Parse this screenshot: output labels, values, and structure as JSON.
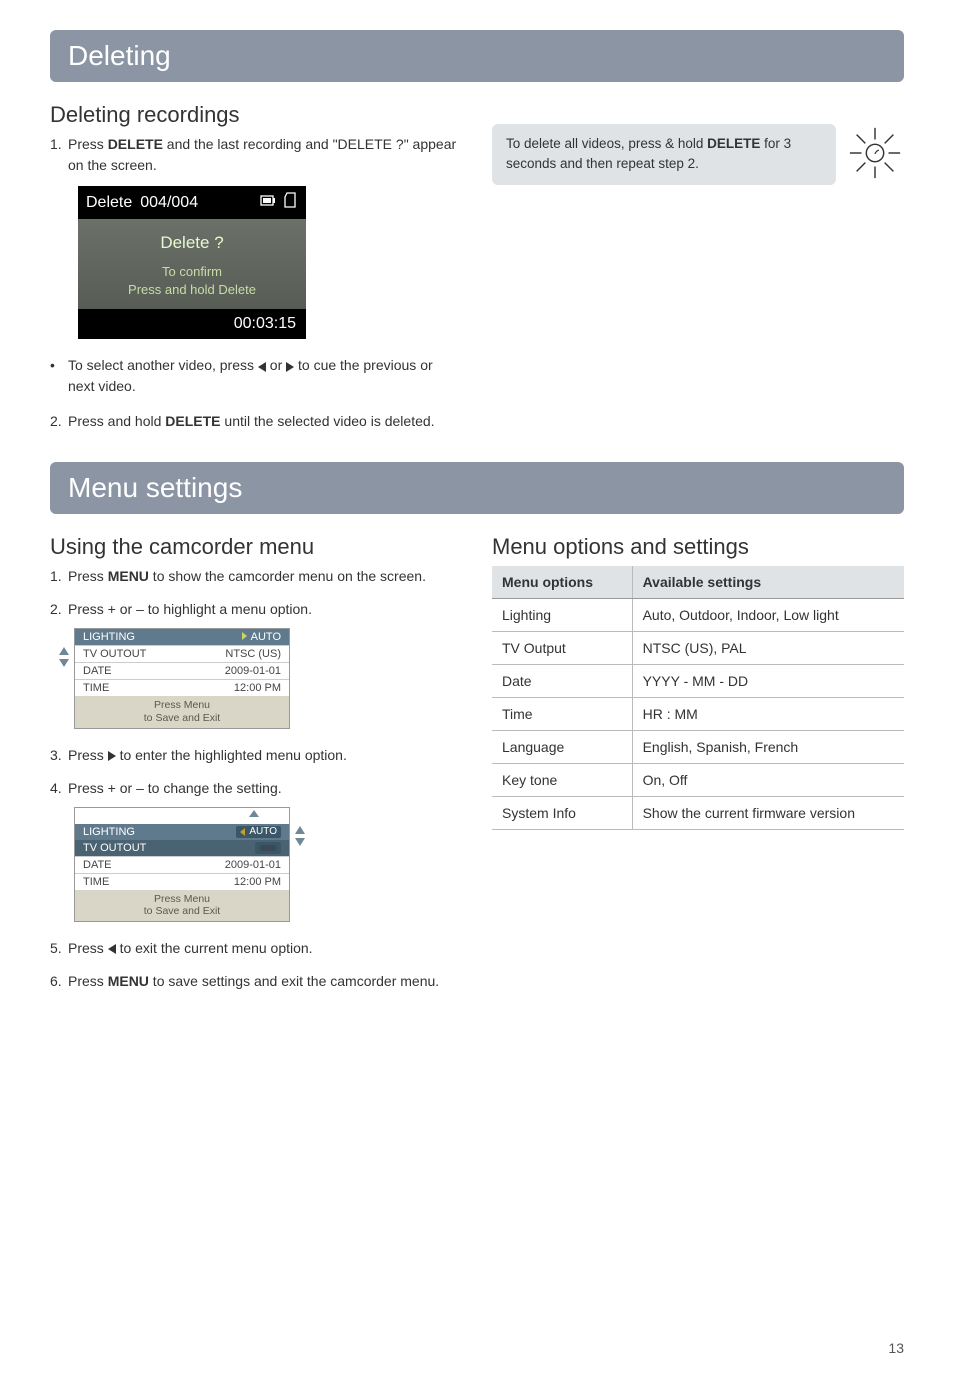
{
  "section1": {
    "heading": "Deleting",
    "sub_heading": "Deleting recordings",
    "step1_num": "1.",
    "step1_pre": "Press ",
    "step1_bold": "DELETE",
    "step1_post": " and the last recording and \"DELETE ?\" appear on the screen.",
    "cam": {
      "delete_label": "Delete",
      "counter": "004/004",
      "question": "Delete ?",
      "hint1": "To confirm",
      "hint2": "Press and hold Delete",
      "time": "00:03:15"
    },
    "bullet_pre": "To select another video, press ",
    "bullet_mid": " or ",
    "bullet_post": " to cue the previous or next video.",
    "step2_num": "2.",
    "step2_pre": "Press and hold ",
    "step2_bold": "DELETE",
    "step2_post": " until the selected video is deleted.",
    "tip_pre": "To delete all videos, press & hold ",
    "tip_bold": "DELETE",
    "tip_post": " for 3 seconds and then repeat step 2."
  },
  "section2": {
    "heading": "Menu settings",
    "left": {
      "sub_heading": "Using the camcorder menu",
      "s1_num": "1.",
      "s1_pre": "Press ",
      "s1_bold": "MENU",
      "s1_post": " to show the camcorder menu on the screen.",
      "s2_num": "2.",
      "s2_text": "Press + or – to highlight a menu option.",
      "lcd1": {
        "r1a": "LIGHTING",
        "r1b": "AUTO",
        "r2a": "TV OUTOUT",
        "r2b": "NTSC (US)",
        "r3a": "DATE",
        "r3b": "2009-01-01",
        "r4a": "TIME",
        "r4b": "12:00 PM",
        "f1": "Press Menu",
        "f2": "to Save and Exit"
      },
      "s3_num": "3.",
      "s3_pre": "Press ",
      "s3_post": " to enter the highlighted menu option.",
      "s4_num": "4.",
      "s4_text": "Press + or – to change the setting.",
      "lcd2": {
        "r1a": "LIGHTING",
        "r1b": "AUTO",
        "r2a": "TV OUTOUT",
        "r2b": "",
        "r3a": "DATE",
        "r3b": "2009-01-01",
        "r4a": "TIME",
        "r4b": "12:00 PM",
        "f1": "Press Menu",
        "f2": "to Save and Exit"
      },
      "s5_num": "5.",
      "s5_pre": "Press ",
      "s5_post": " to exit the current menu option.",
      "s6_num": "6.",
      "s6_pre": "Press ",
      "s6_bold": "MENU",
      "s6_post": " to save settings and exit the camcorder menu."
    },
    "right": {
      "sub_heading": "Menu options and settings",
      "th1": "Menu options",
      "th2": "Available settings",
      "rows": [
        {
          "a": "Lighting",
          "b": "Auto, Outdoor, Indoor, Low light"
        },
        {
          "a": "TV Output",
          "b": "NTSC (US), PAL"
        },
        {
          "a": "Date",
          "b": "YYYY - MM - DD"
        },
        {
          "a": "Time",
          "b": "HR : MM"
        },
        {
          "a": "Language",
          "b": "English, Spanish, French"
        },
        {
          "a": "Key tone",
          "b": "On, Off"
        },
        {
          "a": "System Info",
          "b": "Show the current firmware version"
        }
      ]
    }
  },
  "page_number": "13"
}
